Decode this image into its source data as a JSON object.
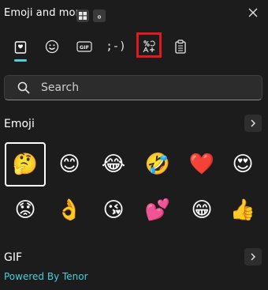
{
  "header": {
    "title": "Emoji and more"
  },
  "tabs": [
    {
      "name": "favorites",
      "icon": "heart-clipboard-icon",
      "selected": true
    },
    {
      "name": "emoji",
      "icon": "smiley-icon"
    },
    {
      "name": "gif",
      "icon": "gif-icon",
      "label": "GIF"
    },
    {
      "name": "kaomoji",
      "icon": "kaomoji-icon",
      "label": ";-)"
    },
    {
      "name": "symbols",
      "icon": "symbols-icon",
      "highlighted": true
    },
    {
      "name": "clipboard",
      "icon": "clipboard-icon"
    }
  ],
  "search": {
    "placeholder": "Search"
  },
  "emoji_section": {
    "title": "Emoji",
    "items": [
      {
        "name": "thinking-face",
        "char": "🤔",
        "selected": true
      },
      {
        "name": "smiling-face",
        "char": "😊"
      },
      {
        "name": "tears-of-joy",
        "char": "😂"
      },
      {
        "name": "rolling-laughing",
        "char": "🤣"
      },
      {
        "name": "red-heart",
        "char": "❤️"
      },
      {
        "name": "heart-eyes",
        "char": "😍"
      },
      {
        "name": "pleading-face",
        "char": "😟"
      },
      {
        "name": "ok-hand",
        "char": "👌"
      },
      {
        "name": "blowing-kiss",
        "char": "😘"
      },
      {
        "name": "two-hearts",
        "char": "💕"
      },
      {
        "name": "grinning-face",
        "char": "😁"
      },
      {
        "name": "thumbs-up",
        "char": "👍"
      }
    ]
  },
  "gif_section": {
    "title": "GIF",
    "powered_by": "Powered By Tenor"
  },
  "colors": {
    "background": "#1c1c1c",
    "accent": "#49d0d8",
    "highlight": "#e0191e"
  }
}
